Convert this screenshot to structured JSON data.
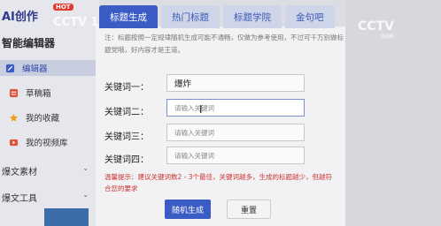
{
  "sidebar": {
    "brand": "AI创作",
    "hot_badge": "HOT",
    "section_title": "智能编辑器",
    "items": [
      {
        "label": "编辑器",
        "icon": "edit-icon",
        "active": true
      },
      {
        "label": "草稿箱",
        "icon": "draft-icon",
        "active": false
      },
      {
        "label": "我的收藏",
        "icon": "star-icon",
        "active": false
      },
      {
        "label": "我的视频库",
        "icon": "video-icon",
        "active": false
      }
    ],
    "groups": [
      {
        "label": "爆文素材"
      },
      {
        "label": "爆文工具"
      }
    ]
  },
  "watermark": {
    "logo_top": "CCTV 13",
    "logo_right": "CCTV",
    "logo_right_sub": "央视网"
  },
  "tabs": [
    {
      "label": "标题生成",
      "active": true
    },
    {
      "label": "热门标题",
      "active": false
    },
    {
      "label": "标题学院",
      "active": false
    },
    {
      "label": "金句吧",
      "active": false
    }
  ],
  "notice": "注：标题按照一定规律随机生成可能不通畅，仅做为参考使用，不过可千万别做标题党哦，好内容才是王道。",
  "fields": [
    {
      "label": "关键词一：",
      "value": "爆炸",
      "placeholder": ""
    },
    {
      "label": "关键词二：",
      "value": "",
      "placeholder": "请输入关键词"
    },
    {
      "label": "关键词三：",
      "value": "",
      "placeholder": "请输入关键词"
    },
    {
      "label": "关键词四：",
      "value": "",
      "placeholder": "请输入关键词"
    }
  ],
  "hint": "温馨提示：建议关键词数2 - 3个最佳，关键词越多，生成的标题越少，但越符合您的要求",
  "buttons": {
    "generate": "随机生成",
    "reset": "重置"
  },
  "colors": {
    "accent": "#3a5cc4",
    "hint_red": "#c33333",
    "hot_red": "#e03b2f"
  }
}
